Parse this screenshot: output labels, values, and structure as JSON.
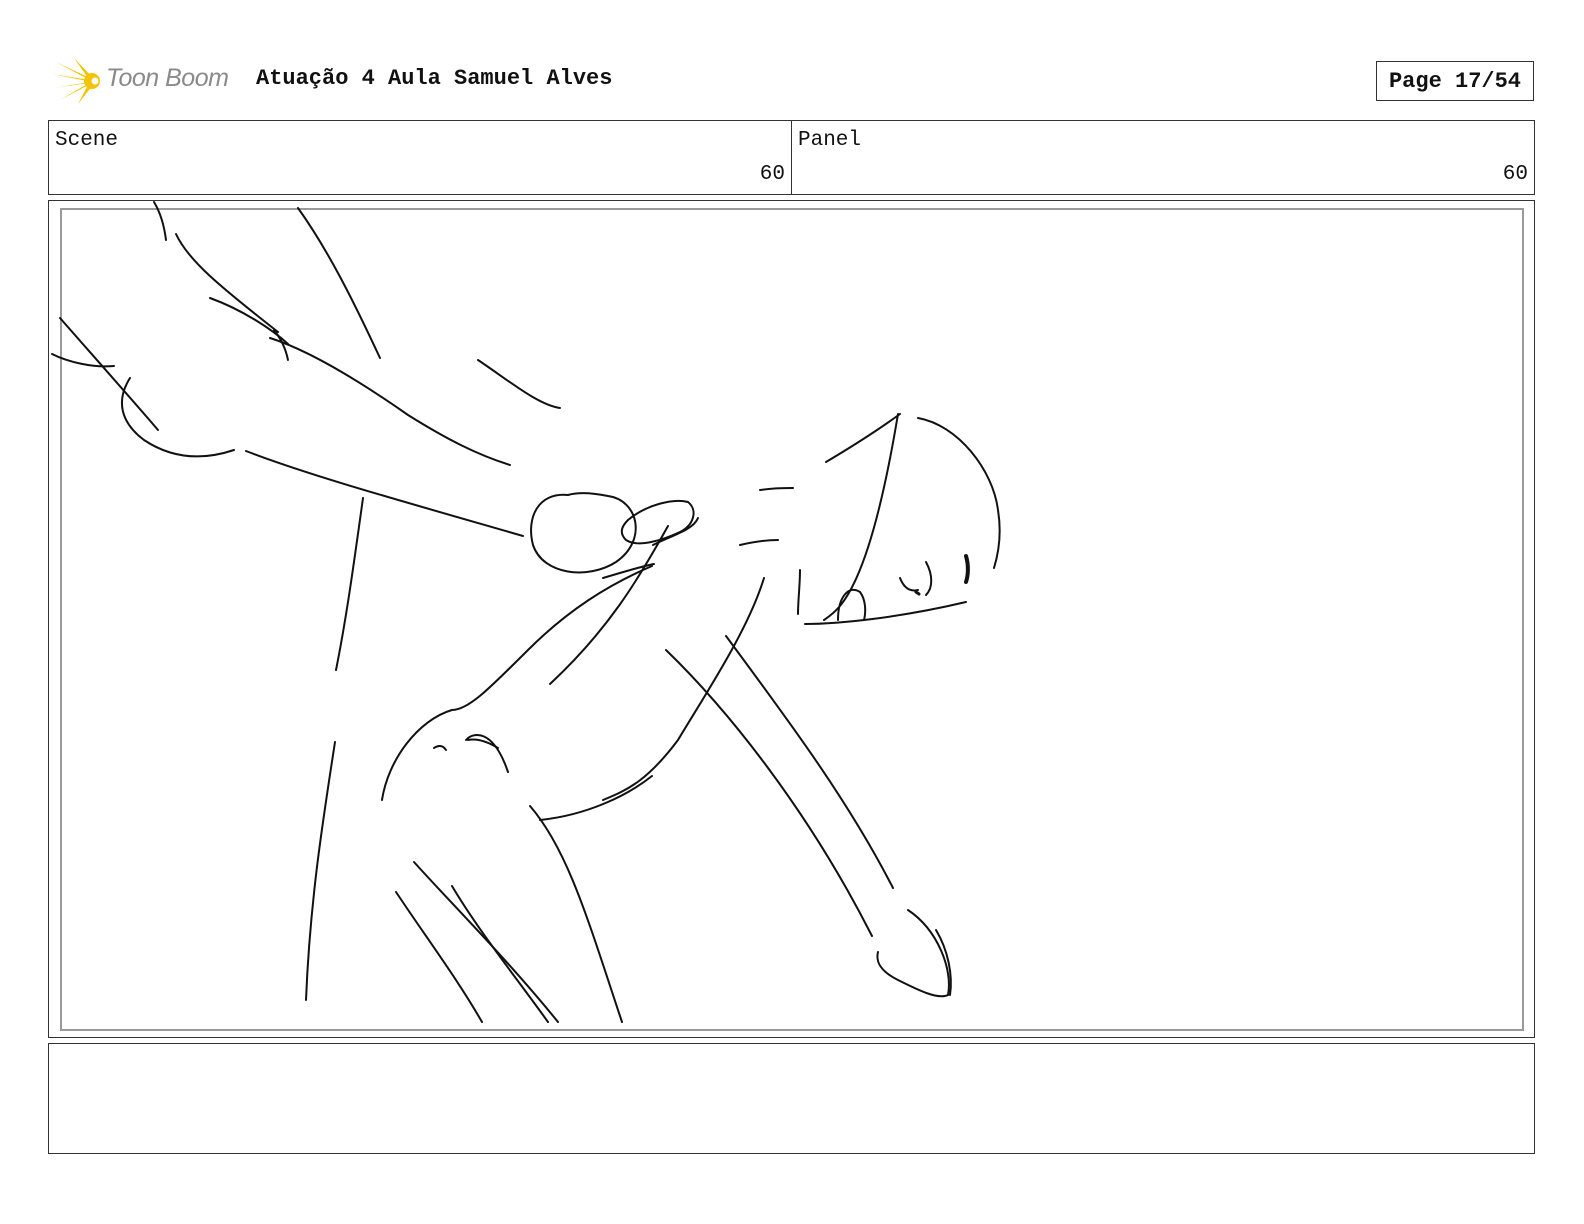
{
  "header": {
    "brand": "Toon Boom",
    "title": "Atuação 4 Aula Samuel Alves",
    "page": "Page 17/54"
  },
  "info": {
    "scene_label": "Scene",
    "scene_value": "60",
    "panel_label": "Panel",
    "panel_value": "60"
  },
  "panel": {
    "image": "storyboard-sketch",
    "notes": ""
  },
  "colors": {
    "logo_yellow": "#f5c400",
    "logo_text": "#8a8a8a",
    "border": "#333333",
    "inner_frame": "#9a9a9a"
  }
}
